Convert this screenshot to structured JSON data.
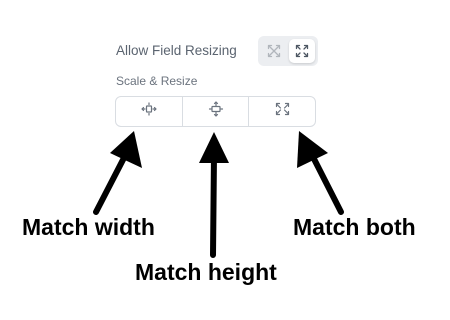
{
  "settings": {
    "allow_field_resizing": {
      "label": "Allow Field Resizing",
      "options": [
        {
          "icon": "resize-disabled-icon",
          "selected": false
        },
        {
          "icon": "resize-expand-icon",
          "selected": true
        }
      ]
    },
    "scale_resize": {
      "label": "Scale & Resize",
      "options": [
        {
          "icon": "match-width-icon"
        },
        {
          "icon": "match-height-icon"
        },
        {
          "icon": "match-both-icon"
        }
      ]
    }
  },
  "annotations": {
    "match_width": "Match width",
    "match_height": "Match height",
    "match_both": "Match both"
  },
  "colors": {
    "label": "#5b6470",
    "border": "#d9dde2",
    "toggle_track": "#eceef1",
    "icon": "#6b737e",
    "annotation": "#000000"
  }
}
